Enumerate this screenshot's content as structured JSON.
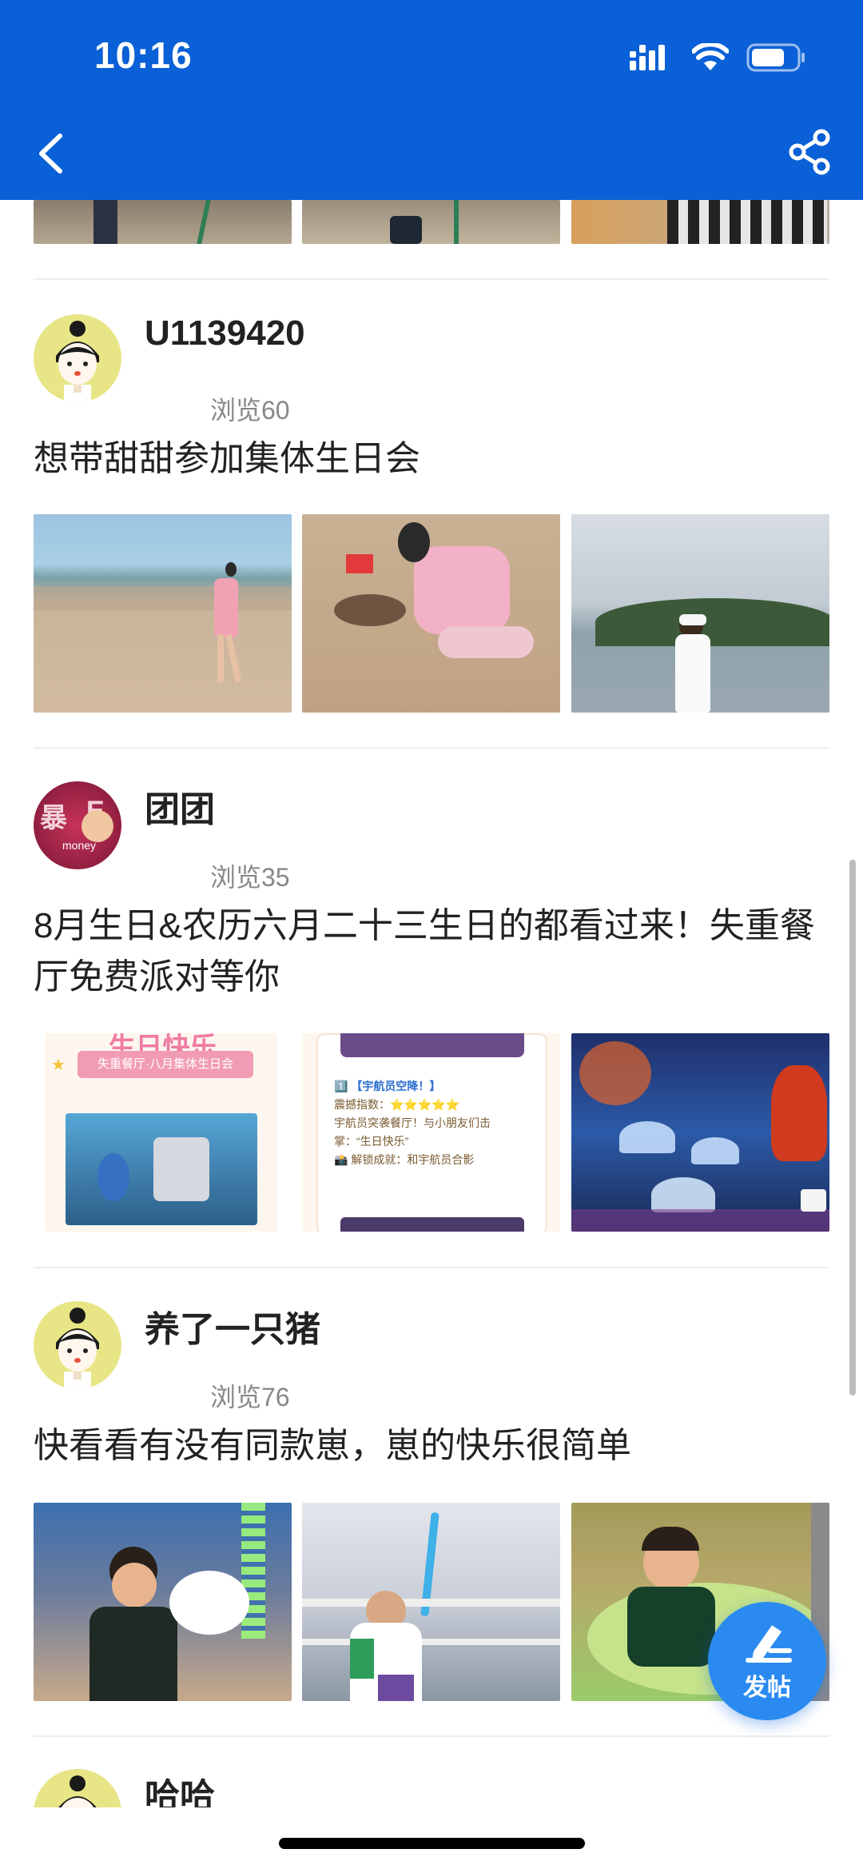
{
  "status_bar": {
    "time": "10:16"
  },
  "posts": [
    {
      "username": "U1139420",
      "views": "浏览60",
      "title": "想带甜甜参加集体生日会"
    },
    {
      "username": "团团",
      "views": "浏览35",
      "title": "8月生日&农历六月二十三生日的都看过来！失重餐厅免费派对等你",
      "avatar_text": [
        "暴",
        "E",
        "money"
      ],
      "poster_left": {
        "heading": "生日快乐",
        "ribbon": "失重餐厅·八月集体生日会"
      },
      "poster_mid": {
        "lines": [
          "1️⃣ 【宇航员空降！】",
          "震撼指数：⭐⭐⭐⭐⭐",
          "宇航员突袭餐厅！与小朋友们击",
          "掌：“生日快乐”",
          "📸 解锁成就：和宇航员合影"
        ]
      }
    },
    {
      "username": "养了一只猪",
      "views": "浏览76",
      "title": "快看看有没有同款崽，崽的快乐很简单"
    },
    {
      "username": "哈哈",
      "views": "",
      "title": ""
    }
  ],
  "fab": {
    "label": "发帖"
  },
  "colors": {
    "header": "#0a60d6",
    "fab": "#2a8af0",
    "avatar_bg": "#e8e586"
  }
}
